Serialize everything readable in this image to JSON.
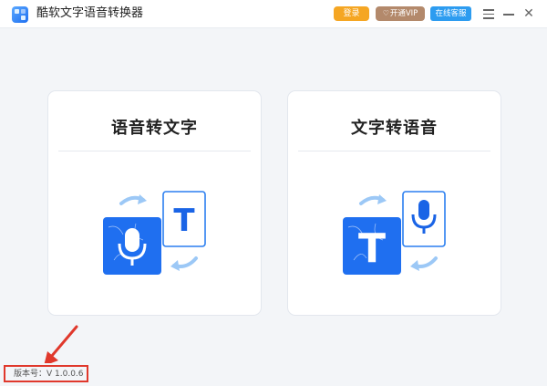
{
  "app": {
    "title": "酷软文字语音转换器",
    "logo_icon": "app-logo-icon"
  },
  "header": {
    "login_label": "登录",
    "vip_label": "开通VIP",
    "service_label": "在线客服",
    "colors": {
      "login": "#f5a623",
      "vip": "#b3896b",
      "service": "#2d9cf0"
    }
  },
  "cards": [
    {
      "title": "语音转文字",
      "illustration": "voice-to-text-illustration"
    },
    {
      "title": "文字转语音",
      "illustration": "text-to-voice-illustration"
    }
  ],
  "footer": {
    "version": "版本号：V 1.0.0.6",
    "highlight_color": "#e0382c"
  }
}
